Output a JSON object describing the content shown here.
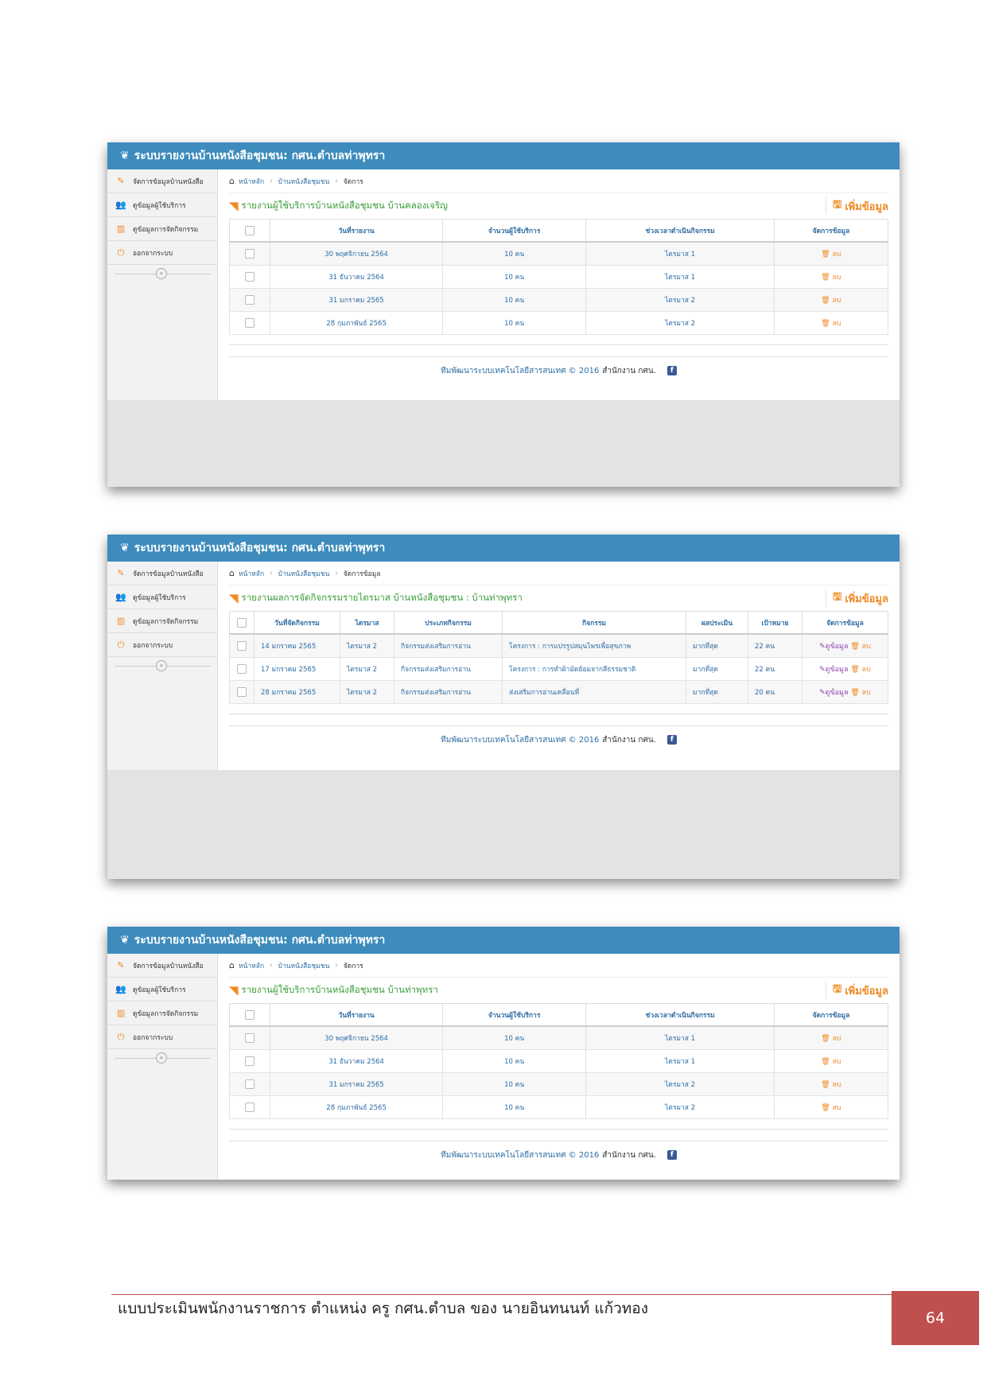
{
  "app": {
    "title": "ระบบรายงานบ้านหนังสือชุมชน: กศน.ตำบลท่าพุทรา",
    "sidebar": [
      {
        "icon": "edit-icon",
        "label": "จัดการข้อมูลบ้านหนังสือ"
      },
      {
        "icon": "users-icon",
        "label": "ดูข้อมูลผู้ใช้บริการ"
      },
      {
        "icon": "bar-chart-icon",
        "label": "ดูข้อมูลการจัดกิจกรรม"
      },
      {
        "icon": "power-icon",
        "label": "ออกจากระบบ"
      }
    ],
    "add_label": "เพิ่มข้อมูล",
    "delete_label": "ลบ",
    "view_label": "ดูข้อมูล",
    "footer": {
      "team": "ทีมพัฒนาระบบเทคโนโลยีสารสนเทศ © 2016",
      "office": "สำนักงาน กศน.",
      "fb": "f"
    }
  },
  "screens": [
    {
      "breadcrumb": [
        "หน้าหลัก",
        "บ้านหนังสือชุมชน",
        "จัดการ"
      ],
      "heading": "รายงานผู้ใช้บริการบ้านหนังสือชุมชน บ้านคลองเจริญ",
      "columns": [
        "วันที่รายงาน",
        "จำนวนผู้ใช้บริการ",
        "ช่วงเวลาดำเนินกิจกรรม",
        "จัดการข้อมูล"
      ],
      "rows": [
        [
          "30 พฤศจิกายน 2564",
          "10 คน",
          "ไตรมาส 1"
        ],
        [
          "31 ธันวาคม 2564",
          "10 คน",
          "ไตรมาส 1"
        ],
        [
          "31 มกราคม 2565",
          "10 คน",
          "ไตรมาส 2"
        ],
        [
          "28 กุมภาพันธ์ 2565",
          "10 คน",
          "ไตรมาส 2"
        ]
      ]
    },
    {
      "breadcrumb": [
        "หน้าหลัก",
        "บ้านหนังสือชุมชน",
        "จัดการข้อมูล"
      ],
      "heading": "รายงานผลการจัดกิจกรรมรายไตรมาส บ้านหนังสือชุมชน : บ้านท่าพุทรา",
      "columns": [
        "วันที่จัดกิจกรรม",
        "ไตรมาส",
        "ประเภทกิจกรรม",
        "กิจกรรม",
        "ผลประเมิน",
        "เป้าหมาย",
        "จัดการข้อมูล"
      ],
      "rows": [
        [
          "14 มกราคม 2565",
          "ไตรมาส 2",
          "กิจกรรมส่งเสริมการอ่าน",
          "โครงการ : การแปรรูปสมุนไพรเพื่อสุขภาพ",
          "มากที่สุด",
          "22 คน"
        ],
        [
          "17 มกราคม 2565",
          "ไตรมาส 2",
          "กิจกรรมส่งเสริมการอ่าน",
          "โครงการ : การทำผ้ามัดย้อมจากสีธรรมชาติ",
          "มากที่สุด",
          "22 คน"
        ],
        [
          "28 มกราคม 2565",
          "ไตรมาส 2",
          "กิจกรรมส่งเสริมการอ่าน",
          "ส่งเสริมการอ่านเคลื่อนที่",
          "มากที่สุด",
          "20 คน"
        ]
      ]
    },
    {
      "breadcrumb": [
        "หน้าหลัก",
        "บ้านหนังสือชุมชน",
        "จัดการ"
      ],
      "heading": "รายงานผู้ใช้บริการบ้านหนังสือชุมชน บ้านท่าพุทรา",
      "columns": [
        "วันที่รายงาน",
        "จำนวนผู้ใช้บริการ",
        "ช่วงเวลาดำเนินกิจกรรม",
        "จัดการข้อมูล"
      ],
      "rows": [
        [
          "30 พฤศจิกายน 2564",
          "10 คน",
          "ไตรมาส 1"
        ],
        [
          "31 ธันวาคม 2564",
          "10 คน",
          "ไตรมาส 1"
        ],
        [
          "31 มกราคม 2565",
          "10 คน",
          "ไตรมาส 2"
        ],
        [
          "28 กุมภาพันธ์ 2565",
          "10 คน",
          "ไตรมาส 2"
        ]
      ]
    }
  ],
  "document": {
    "footer_text": "แบบประเมินพนักงานราชการ ตำแหน่ง ครู กศน.ตำบล ของ นายอินทนนท์ แก้วทอง",
    "page_number": "64"
  }
}
